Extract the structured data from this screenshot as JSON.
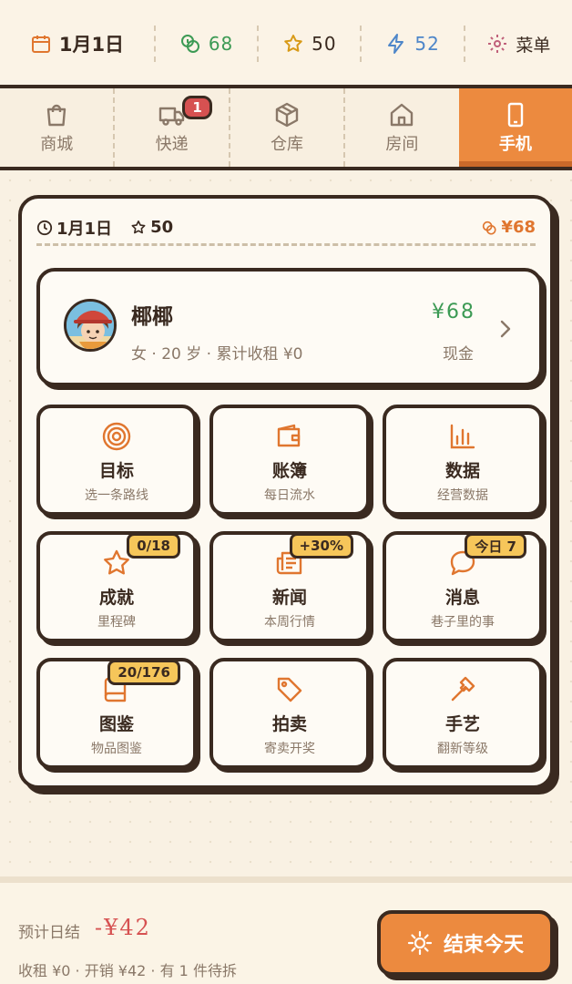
{
  "status": {
    "date": "1月1日",
    "coins": "68",
    "stars": "50",
    "energy": "52",
    "menu": "菜单"
  },
  "tabs": [
    {
      "label": "商城",
      "icon": "bag-icon"
    },
    {
      "label": "快递",
      "icon": "truck-icon",
      "badge": "1"
    },
    {
      "label": "仓库",
      "icon": "box-icon"
    },
    {
      "label": "房间",
      "icon": "house-icon"
    },
    {
      "label": "手机",
      "icon": "phone-icon",
      "active": true
    }
  ],
  "panel": {
    "date": "1月1日",
    "stars": "50",
    "money": "¥68"
  },
  "profile": {
    "name": "椰椰",
    "subtitle": "女 · 20 岁 · 累计收租 ¥0",
    "cash": "¥68",
    "cash_label": "现金"
  },
  "cards": [
    {
      "title": "目标",
      "sub": "选一条路线",
      "icon": "target-icon"
    },
    {
      "title": "账簿",
      "sub": "每日流水",
      "icon": "wallet-icon"
    },
    {
      "title": "数据",
      "sub": "经营数据",
      "icon": "bar-chart-icon"
    },
    {
      "title": "成就",
      "sub": "里程碑",
      "icon": "star-icon",
      "badge": "0/18"
    },
    {
      "title": "新闻",
      "sub": "本周行情",
      "icon": "newspaper-icon",
      "badge": "+30%"
    },
    {
      "title": "消息",
      "sub": "巷子里的事",
      "icon": "chat-bubble-icon",
      "badge": "今日 7"
    },
    {
      "title": "图鉴",
      "sub": "物品图鉴",
      "icon": "book-icon",
      "badge": "20/176"
    },
    {
      "title": "拍卖",
      "sub": "寄卖开奖",
      "icon": "tag-icon"
    },
    {
      "title": "手艺",
      "sub": "翻新等级",
      "icon": "hammer-icon"
    }
  ],
  "footer": {
    "estimate_label": "预计日结",
    "estimate_amount": "-¥42",
    "detail": "收租 ¥0 · 开销 ¥42 · 有 1 件待拆",
    "end_button": "结束今天"
  },
  "colors": {
    "accent": "#ec8a3f",
    "ink": "#3a2a20",
    "money_green": "#3c9a54",
    "alert_red": "#d65151",
    "badge_yellow": "#f6c65a",
    "energy_blue": "#4e86c9"
  }
}
